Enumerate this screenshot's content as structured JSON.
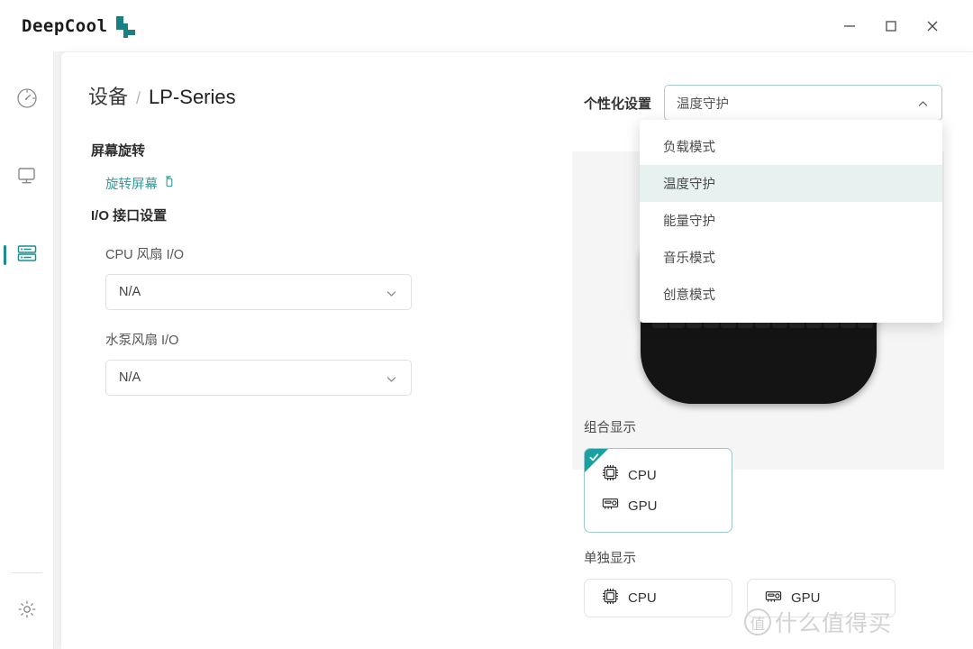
{
  "window": {
    "brand": "DeepCool",
    "controls": [
      {
        "name": "minimize",
        "label": "–"
      },
      {
        "name": "maximize",
        "label": "□"
      },
      {
        "name": "close",
        "label": "✕"
      }
    ]
  },
  "sidebar": {
    "items": [
      {
        "icon": "dashboard-gauge-icon",
        "active": false
      },
      {
        "icon": "monitor-icon",
        "active": false
      },
      {
        "icon": "server-list-icon",
        "active": true
      }
    ],
    "footer": {
      "icon": "gear-icon"
    }
  },
  "breadcrumb": {
    "root": "设备",
    "separator": "/",
    "current": "LP-Series"
  },
  "personalization": {
    "label": "个性化设置",
    "selected": "温度守护",
    "expanded": true,
    "caret_icon": "chevron-up-icon",
    "options": [
      "负载模式",
      "温度守护",
      "能量守护",
      "音乐模式",
      "创意模式"
    ]
  },
  "settings": {
    "screen_rotation_title": "屏幕旋转",
    "rotate_link": "旋转屏幕",
    "rotate_icon": "rotate-screen-icon",
    "io_title": "I/O 接口设置",
    "fields": [
      {
        "label": "CPU 风扇 I/O",
        "value": "N/A",
        "caret_icon": "chevron-down-icon"
      },
      {
        "label": "水泵风扇 I/O",
        "value": "N/A",
        "caret_icon": "chevron-down-icon"
      }
    ]
  },
  "preview": {
    "device_name": "lp-series-led-display",
    "led_rows": [
      [
        0,
        1,
        1,
        1,
        0,
        1,
        1,
        1,
        0,
        0,
        1,
        0,
        0
      ],
      [
        0,
        1,
        0,
        0,
        0,
        0,
        1,
        0,
        0,
        0,
        1,
        0,
        0
      ],
      [
        0,
        1,
        1,
        1,
        0,
        1,
        1,
        1,
        0,
        0,
        1,
        1,
        0
      ],
      [
        0,
        0,
        0,
        0,
        0,
        0,
        0,
        0,
        0,
        0,
        0,
        0,
        0
      ]
    ]
  },
  "display_options": {
    "combined": {
      "title": "组合显示",
      "selected": true,
      "check_icon": "check-icon",
      "items": [
        {
          "label": "CPU",
          "icon": "cpu-chip-icon"
        },
        {
          "label": "GPU",
          "icon": "gpu-card-icon"
        }
      ]
    },
    "single": {
      "title": "单独显示",
      "items": [
        {
          "label": "CPU",
          "icon": "cpu-chip-icon"
        },
        {
          "label": "GPU",
          "icon": "gpu-card-icon"
        }
      ]
    }
  },
  "watermark": {
    "badge": "值",
    "text": "什么值得买"
  },
  "colors": {
    "accent": "#1a8d90",
    "accent_soft": "#e6f1f0",
    "page_bg": "#f3f3f3",
    "panel_bg": "#f5f5f5",
    "device": "#141414"
  }
}
